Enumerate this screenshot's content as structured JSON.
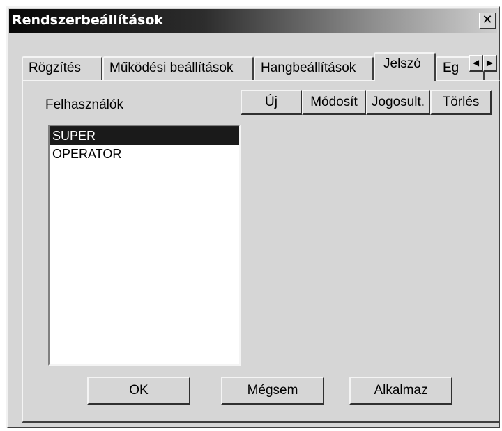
{
  "window": {
    "title": "Rendszerbeállítások",
    "close_glyph": "✕"
  },
  "tabs": [
    {
      "label": "Rögzítés",
      "active": false
    },
    {
      "label": "Működési beállítások",
      "active": false
    },
    {
      "label": "Hangbeállítások",
      "active": false
    },
    {
      "label": "Jelszó",
      "active": true
    },
    {
      "label": "Eg",
      "active": false
    }
  ],
  "tab_scroll": {
    "left_glyph": "◀",
    "right_glyph": "▶"
  },
  "users": {
    "label": "Felhasználók",
    "items": [
      "SUPER",
      "OPERATOR"
    ],
    "selected": "SUPER"
  },
  "user_actions": {
    "new": "Új",
    "modify": "Módosít",
    "permissions": "Jogosult.",
    "delete": "Törlés"
  },
  "footer": {
    "ok": "OK",
    "cancel": "Mégsem",
    "apply": "Alkalmaz"
  }
}
